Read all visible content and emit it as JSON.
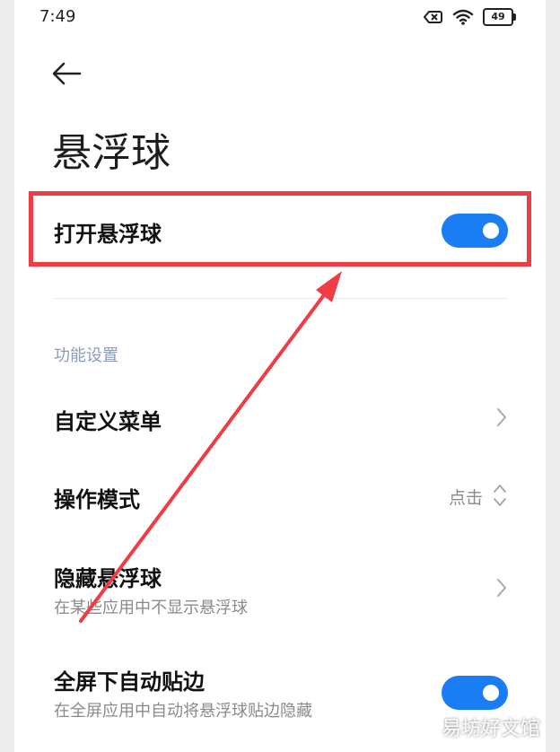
{
  "status_bar": {
    "time": "7:49",
    "battery_level": "49"
  },
  "header": {
    "title": "悬浮球"
  },
  "main_toggle": {
    "label": "打开悬浮球",
    "enabled": true
  },
  "section": {
    "label": "功能设置"
  },
  "settings": [
    {
      "title": "自定义菜单"
    },
    {
      "title": "操作模式",
      "value": "点击"
    },
    {
      "title": "隐藏悬浮球",
      "subtitle": "在某些应用中不显示悬浮球"
    },
    {
      "title": "全屏下自动贴边",
      "subtitle": "在全屏应用中自动将悬浮球贴边隐藏",
      "enabled": true
    }
  ],
  "colors": {
    "accent": "#1a7df3",
    "annotation": "#ef3c45"
  },
  "watermark": "易坊好文馆"
}
